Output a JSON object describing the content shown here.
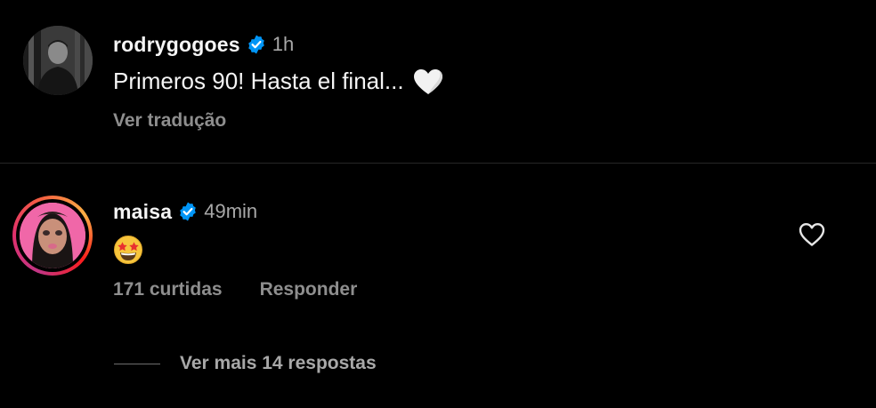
{
  "post": {
    "username": "rodrygogoes",
    "time": "1h",
    "text": "Primeros 90! Hasta el final...",
    "translate_label": "Ver tradução",
    "avatar_icon": "profile-photo",
    "verified_icon": "verified-badge-icon",
    "heart_emoji": "white-heart"
  },
  "comment": {
    "username": "maisa",
    "time": "49min",
    "emoji": "star-struck-emoji",
    "likes_text": "171 curtidas",
    "reply_label": "Responder",
    "more_replies_label": "Ver mais 14 respostas",
    "like_icon": "heart-outline-icon"
  },
  "colors": {
    "background": "#000000",
    "text_primary": "#f5f5f5",
    "text_secondary": "#8e8e8e",
    "verified_blue": "#0095f6",
    "divider": "#262626"
  }
}
